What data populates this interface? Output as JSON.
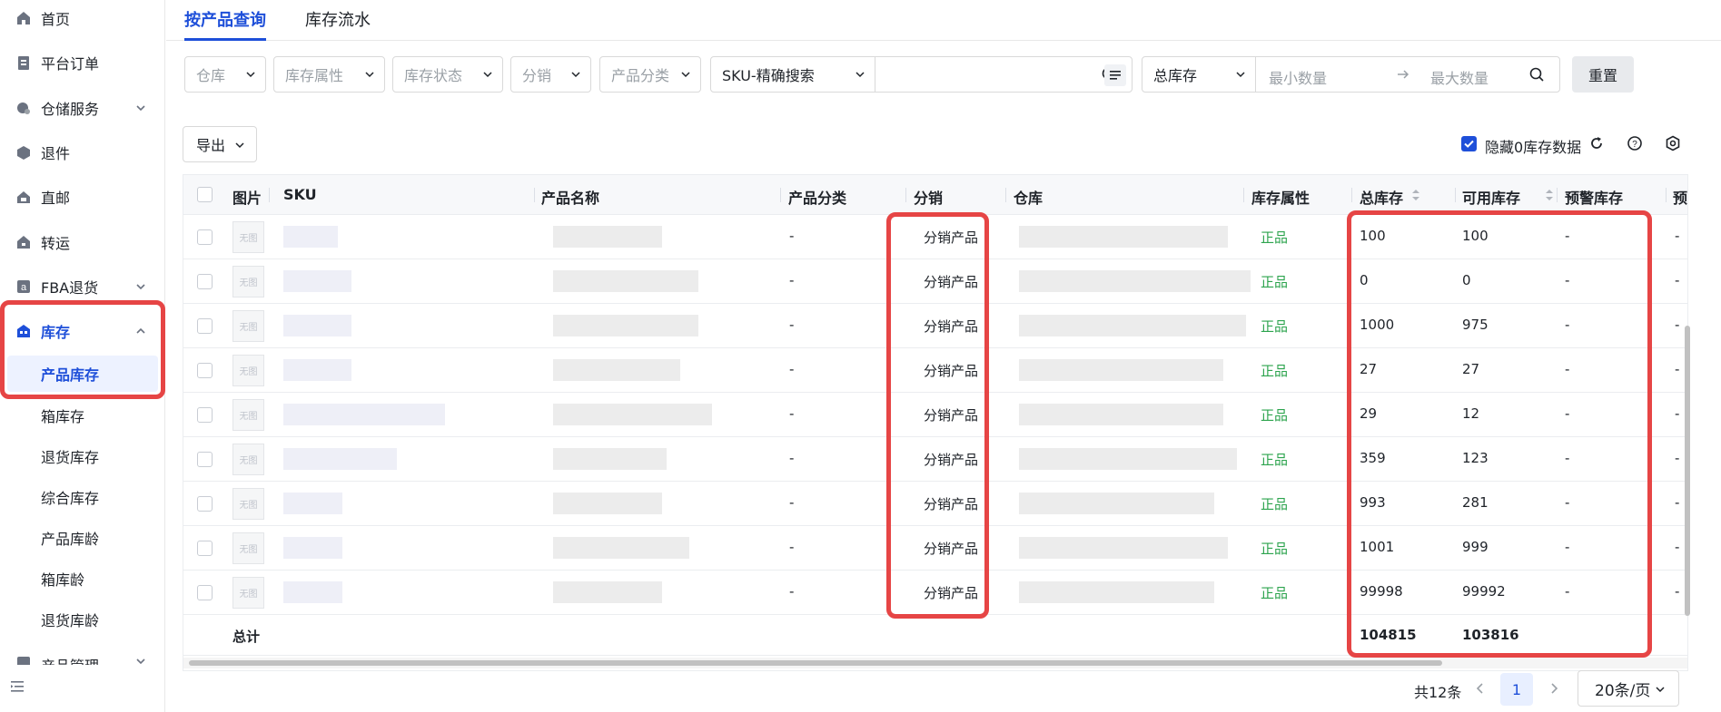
{
  "sidebar": {
    "items": [
      {
        "label": "首页",
        "icon": "home-icon"
      },
      {
        "label": "平台订单",
        "icon": "clipboard-icon"
      },
      {
        "label": "仓储服务",
        "icon": "warehouse-service-icon"
      },
      {
        "label": "退件",
        "icon": "return-box-icon"
      },
      {
        "label": "直邮",
        "icon": "mail-truck-icon"
      },
      {
        "label": "转运",
        "icon": "transfer-icon"
      },
      {
        "label": "FBA退货",
        "icon": "amazon-icon"
      },
      {
        "label": "库存",
        "icon": "inventory-icon"
      }
    ],
    "sub_items": [
      {
        "label": "产品库存"
      },
      {
        "label": "箱库存"
      },
      {
        "label": "退货库存"
      },
      {
        "label": "综合库存"
      },
      {
        "label": "产品库龄"
      },
      {
        "label": "箱库龄"
      },
      {
        "label": "退货库龄"
      }
    ],
    "next_item": "产品管理"
  },
  "tabs": [
    {
      "label": "按产品查询"
    },
    {
      "label": "库存流水"
    }
  ],
  "filters": {
    "warehouse": "仓库",
    "stock_attr": "库存属性",
    "stock_status": "库存状态",
    "distribution": "分销",
    "category": "产品分类",
    "search_mode": "SKU-精确搜索",
    "qty_type": "总库存",
    "min_qty_placeholder": "最小数量",
    "max_qty_placeholder": "最大数量",
    "reset": "重置"
  },
  "toolbar": {
    "export": "导出",
    "hide_zero": "隐藏0库存数据"
  },
  "table": {
    "columns": [
      "图片",
      "SKU",
      "产品名称",
      "产品分类",
      "分销",
      "仓库",
      "库存属性",
      "总库存",
      "可用库存",
      "预警库存",
      "预警"
    ],
    "thumb_text": "无图",
    "rows": [
      {
        "category": "-",
        "distribution": "分销产品",
        "attr": "正品",
        "total": "100",
        "available": "100",
        "warn": "-",
        "warn2": "-"
      },
      {
        "category": "-",
        "distribution": "分销产品",
        "attr": "正品",
        "total": "0",
        "available": "0",
        "warn": "-",
        "warn2": "-"
      },
      {
        "category": "-",
        "distribution": "分销产品",
        "attr": "正品",
        "total": "1000",
        "available": "975",
        "warn": "-",
        "warn2": "-"
      },
      {
        "category": "-",
        "distribution": "分销产品",
        "attr": "正品",
        "total": "27",
        "available": "27",
        "warn": "-",
        "warn2": "-"
      },
      {
        "category": "-",
        "distribution": "分销产品",
        "attr": "正品",
        "total": "29",
        "available": "12",
        "warn": "-",
        "warn2": "-"
      },
      {
        "category": "-",
        "distribution": "分销产品",
        "attr": "正品",
        "total": "359",
        "available": "123",
        "warn": "-",
        "warn2": "-"
      },
      {
        "category": "-",
        "distribution": "分销产品",
        "attr": "正品",
        "total": "993",
        "available": "281",
        "warn": "-",
        "warn2": "-"
      },
      {
        "category": "-",
        "distribution": "分销产品",
        "attr": "正品",
        "total": "1001",
        "available": "999",
        "warn": "-",
        "warn2": "-"
      },
      {
        "category": "-",
        "distribution": "分销产品",
        "attr": "正品",
        "total": "99998",
        "available": "99992",
        "warn": "-",
        "warn2": "-"
      }
    ],
    "total_label": "总计",
    "total_sum": "104815",
    "available_sum": "103816"
  },
  "pagination": {
    "total_text": "共12条",
    "current_page": "1",
    "page_size": "20条/页"
  },
  "colors": {
    "accent": "#1e4fd9",
    "highlight": "#e64545",
    "genuine": "#2da44e"
  }
}
